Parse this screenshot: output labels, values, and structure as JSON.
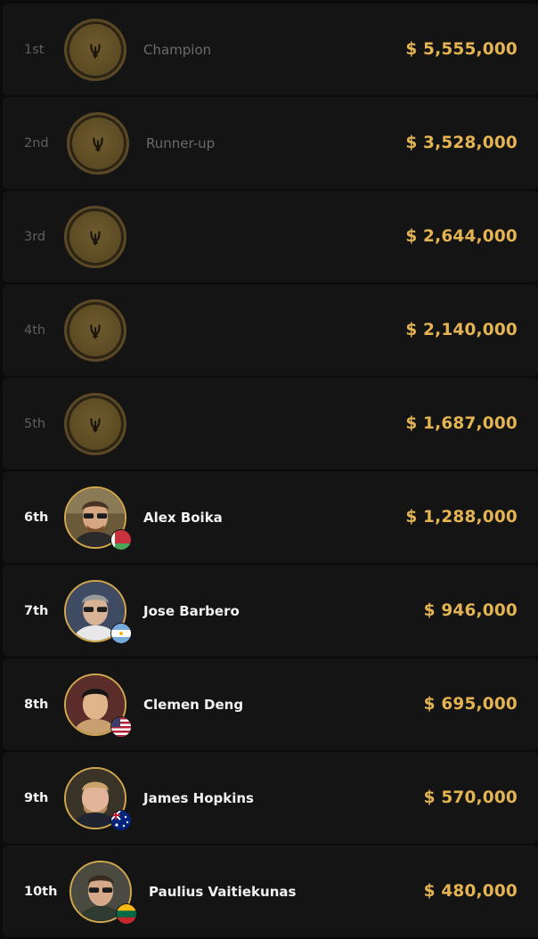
{
  "results": [
    {
      "place": "1st",
      "name": "Champion",
      "prize": "$ 5,555,000",
      "type": "placeholder"
    },
    {
      "place": "2nd",
      "name": "Runner-up",
      "prize": "$ 3,528,000",
      "type": "placeholder"
    },
    {
      "place": "3rd",
      "name": "",
      "prize": "$ 2,644,000",
      "type": "placeholder"
    },
    {
      "place": "4th",
      "name": "",
      "prize": "$ 2,140,000",
      "type": "placeholder"
    },
    {
      "place": "5th",
      "name": "",
      "prize": "$ 1,687,000",
      "type": "placeholder"
    },
    {
      "place": "6th",
      "name": "Alex Boika",
      "prize": "$ 1,288,000",
      "type": "player",
      "flag": "belarus-flag-icon"
    },
    {
      "place": "7th",
      "name": "Jose Barbero",
      "prize": "$ 946,000",
      "type": "player",
      "flag": "argentina-flag-icon"
    },
    {
      "place": "8th",
      "name": "Clemen Deng",
      "prize": "$ 695,000",
      "type": "player",
      "flag": "usa-flag-icon"
    },
    {
      "place": "9th",
      "name": "James Hopkins",
      "prize": "$ 570,000",
      "type": "player",
      "flag": "australia-flag-icon"
    },
    {
      "place": "10th",
      "name": "Paulius Vaitiekunas",
      "prize": "$ 480,000",
      "type": "player",
      "flag": "lithuania-flag-icon"
    }
  ],
  "colors": {
    "background": "#0b0b0b",
    "row": "#141414",
    "gold": "#e4b453",
    "badge": "#5d4b24",
    "muted_text": "#6b6b6b"
  }
}
